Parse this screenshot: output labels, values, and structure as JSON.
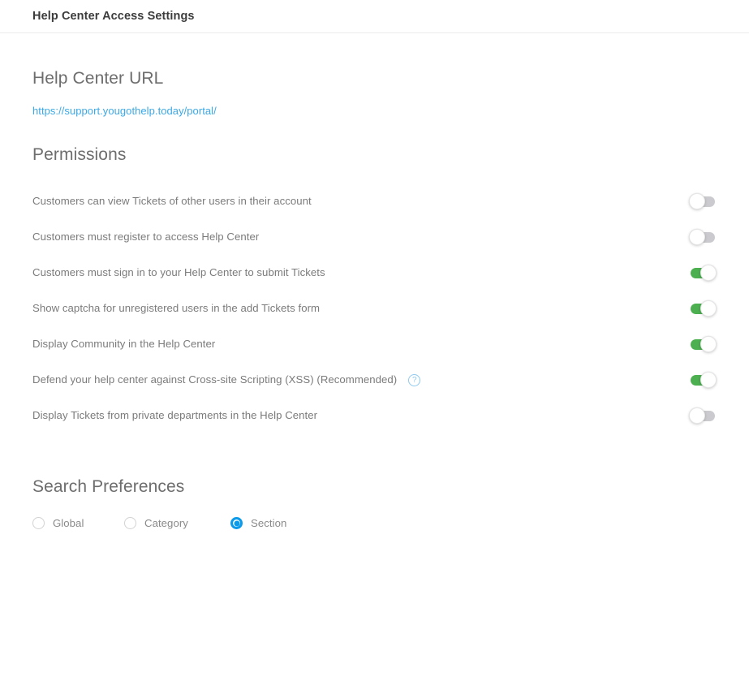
{
  "header": {
    "title": "Help Center Access Settings"
  },
  "url_section": {
    "heading": "Help Center URL",
    "url": "https://support.yougothelp.today/portal/"
  },
  "permissions_section": {
    "heading": "Permissions",
    "rows": [
      {
        "label": "Customers can view Tickets of other users in their account",
        "state": "off",
        "has_help": false
      },
      {
        "label": "Customers must register to access Help Center",
        "state": "off",
        "has_help": false
      },
      {
        "label": "Customers must sign in to your Help Center to submit Tickets",
        "state": "on",
        "has_help": false
      },
      {
        "label": "Show captcha for unregistered users in the add Tickets form",
        "state": "on",
        "has_help": false
      },
      {
        "label": "Display Community in the Help Center",
        "state": "on",
        "has_help": false
      },
      {
        "label": "Defend your help center against Cross-site Scripting (XSS) (Recommended)",
        "state": "on",
        "has_help": true,
        "help_icon": "help-question-icon",
        "help_glyph": "?"
      },
      {
        "label": "Display Tickets from private departments in the Help Center",
        "state": "off",
        "has_help": false
      }
    ]
  },
  "search_section": {
    "heading": "Search Preferences",
    "options": [
      {
        "label": "Global",
        "selected": false
      },
      {
        "label": "Category",
        "selected": false
      },
      {
        "label": "Section",
        "selected": true
      }
    ],
    "selected_value": "Section"
  },
  "colors": {
    "accent_blue": "#0c9aeb",
    "link_blue": "#3ba9e8",
    "toggle_on_green": "#4caf50",
    "toggle_off_grey": "#cbcbcf",
    "help_icon_blue": "#8ec9ef",
    "text_grey": "#7b7b7b",
    "heading_grey": "#6d6d6d",
    "title_dark": "#3c3c3c",
    "divider": "#ececec"
  }
}
